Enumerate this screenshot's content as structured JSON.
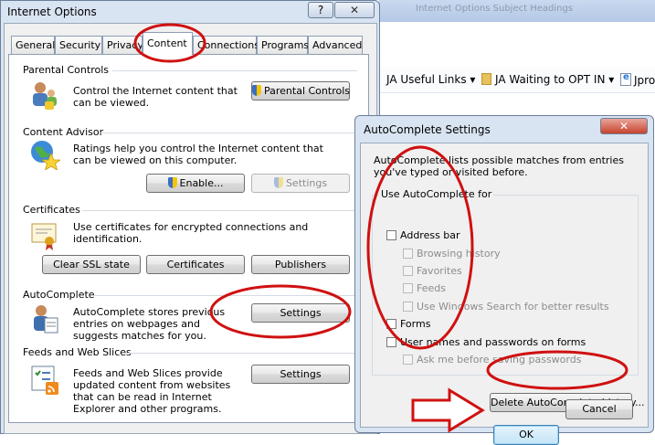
{
  "background_browser": {
    "title": "Internet Options Subject Headings",
    "favorites": [
      {
        "label": "JA Useful Links",
        "icon": "folder-icon-none"
      },
      {
        "label": "JA Waiting to OPT IN",
        "icon": "folder-icon"
      },
      {
        "label": "Jpro",
        "icon": "page-icon"
      }
    ]
  },
  "internet_options": {
    "title": "Internet Options",
    "help_label": "?",
    "close_label": "✕",
    "tabs": [
      "General",
      "Security",
      "Privacy",
      "Content",
      "Connections",
      "Programs",
      "Advanced"
    ],
    "active_tab": "Content",
    "parental_controls": {
      "title": "Parental Controls",
      "text": "Control the Internet content that can be viewed.",
      "button": "Parental Controls"
    },
    "content_advisor": {
      "title": "Content Advisor",
      "text": "Ratings help you control the Internet content that can be viewed on this computer.",
      "enable_button": "Enable...",
      "settings_button": "Settings"
    },
    "certificates": {
      "title": "Certificates",
      "text": "Use certificates for encrypted connections and identification.",
      "clear_ssl_button": "Clear SSL state",
      "certificates_button": "Certificates",
      "publishers_button": "Publishers"
    },
    "autocomplete": {
      "title": "AutoComplete",
      "text": "AutoComplete stores previous entries on webpages and suggests matches for you.",
      "settings_button": "Settings"
    },
    "feeds": {
      "title": "Feeds and Web Slices",
      "text": "Feeds and Web Slices provide updated content from websites that can be read in Internet Explorer and other programs.",
      "settings_button": "Settings"
    }
  },
  "autocomplete_settings": {
    "title": "AutoComplete Settings",
    "close_label": "✕",
    "description": "AutoComplete lists possible matches from entries you've typed or visited before.",
    "group_label": "Use AutoComplete for",
    "options": [
      {
        "label": "Address bar",
        "checked": false,
        "disabled": false,
        "indent": false
      },
      {
        "label": "Browsing history",
        "checked": false,
        "disabled": true,
        "indent": true
      },
      {
        "label": "Favorites",
        "checked": false,
        "disabled": true,
        "indent": true
      },
      {
        "label": "Feeds",
        "checked": false,
        "disabled": true,
        "indent": true
      },
      {
        "label": "Use Windows Search for better results",
        "checked": false,
        "disabled": true,
        "indent": true
      },
      {
        "label": "Forms",
        "checked": false,
        "disabled": false,
        "indent": false
      },
      {
        "label": "User names and passwords on forms",
        "checked": false,
        "disabled": false,
        "indent": false
      },
      {
        "label": "Ask me before saving passwords",
        "checked": false,
        "disabled": true,
        "indent": true
      }
    ],
    "delete_button": "Delete AutoComplete history...",
    "ok_button": "OK",
    "cancel_button": "Cancel"
  },
  "colors": {
    "annotation_red": "#d01010",
    "window_frame": "#d9e4f2",
    "dialog_body": "#f0f0f0"
  }
}
